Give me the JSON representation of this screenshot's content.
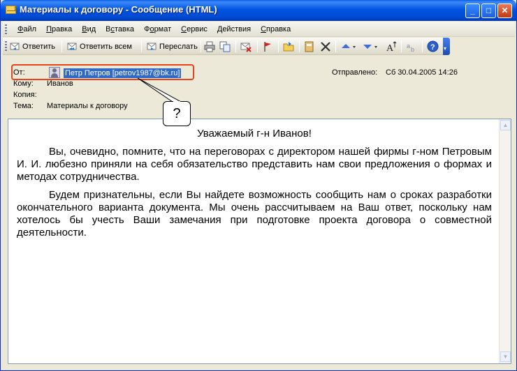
{
  "window": {
    "title": "Материалы к договору - Сообщение (HTML)",
    "minimize": "_",
    "maximize": "□",
    "close": "✕"
  },
  "menu": {
    "items": [
      {
        "label": "Файл",
        "key": "Ф"
      },
      {
        "label": "Правка",
        "key": "П"
      },
      {
        "label": "Вид",
        "key": "В"
      },
      {
        "label": "Вставка",
        "key": "с"
      },
      {
        "label": "Формат",
        "key": "о"
      },
      {
        "label": "Сервис",
        "key": "С"
      },
      {
        "label": "Действия",
        "key": "Д"
      },
      {
        "label": "Справка",
        "key": "С"
      }
    ]
  },
  "toolbar": {
    "reply": "Ответить",
    "reply_all": "Ответить всем",
    "forward": "Переслать",
    "icons": [
      "reply-icon",
      "reply-all-icon",
      "forward-icon",
      "print-icon",
      "copy-icon",
      "delete-message-icon",
      "flag-icon",
      "move-to-folder-icon",
      "address-book-icon",
      "delete-icon",
      "previous-item-icon",
      "next-item-icon",
      "font-size-icon",
      "encoding-icon",
      "help-icon"
    ]
  },
  "header": {
    "from_label": "От:",
    "from_value": "Петр Петров [petrov1987@bk.ru]",
    "to_label": "Кому:",
    "to_value": "Иванов",
    "cc_label": "Копия:",
    "cc_value": "",
    "subject_label": "Тема:",
    "subject_value": "Материалы к договору",
    "sent_label": "Отправлено:",
    "sent_value": "Сб 30.04.2005 14:26"
  },
  "callout": {
    "text": "?"
  },
  "message": {
    "greeting": "Уважаемый г-н Иванов!",
    "paragraph1": "Вы, очевидно, помните, что на переговорах с директором нашей фирмы г-ном Петровым И. И. любезно приняли на себя обязательство представить нам свои предложения о формах и методах сотрудничества.",
    "paragraph2": "Будем признательны, если Вы найдете возможность сообщить нам о сроках разработки окончательного варианта документа. Мы очень рассчитываем на Ваш ответ, поскольку нам хотелось бы учесть Ваши замечания при подготовке проекта договора о совместной деятельности."
  },
  "colors": {
    "titlebar": "#0054e3",
    "highlight_box": "#e8431a",
    "selection": "#316ac5",
    "window_bg": "#ece9d8"
  }
}
